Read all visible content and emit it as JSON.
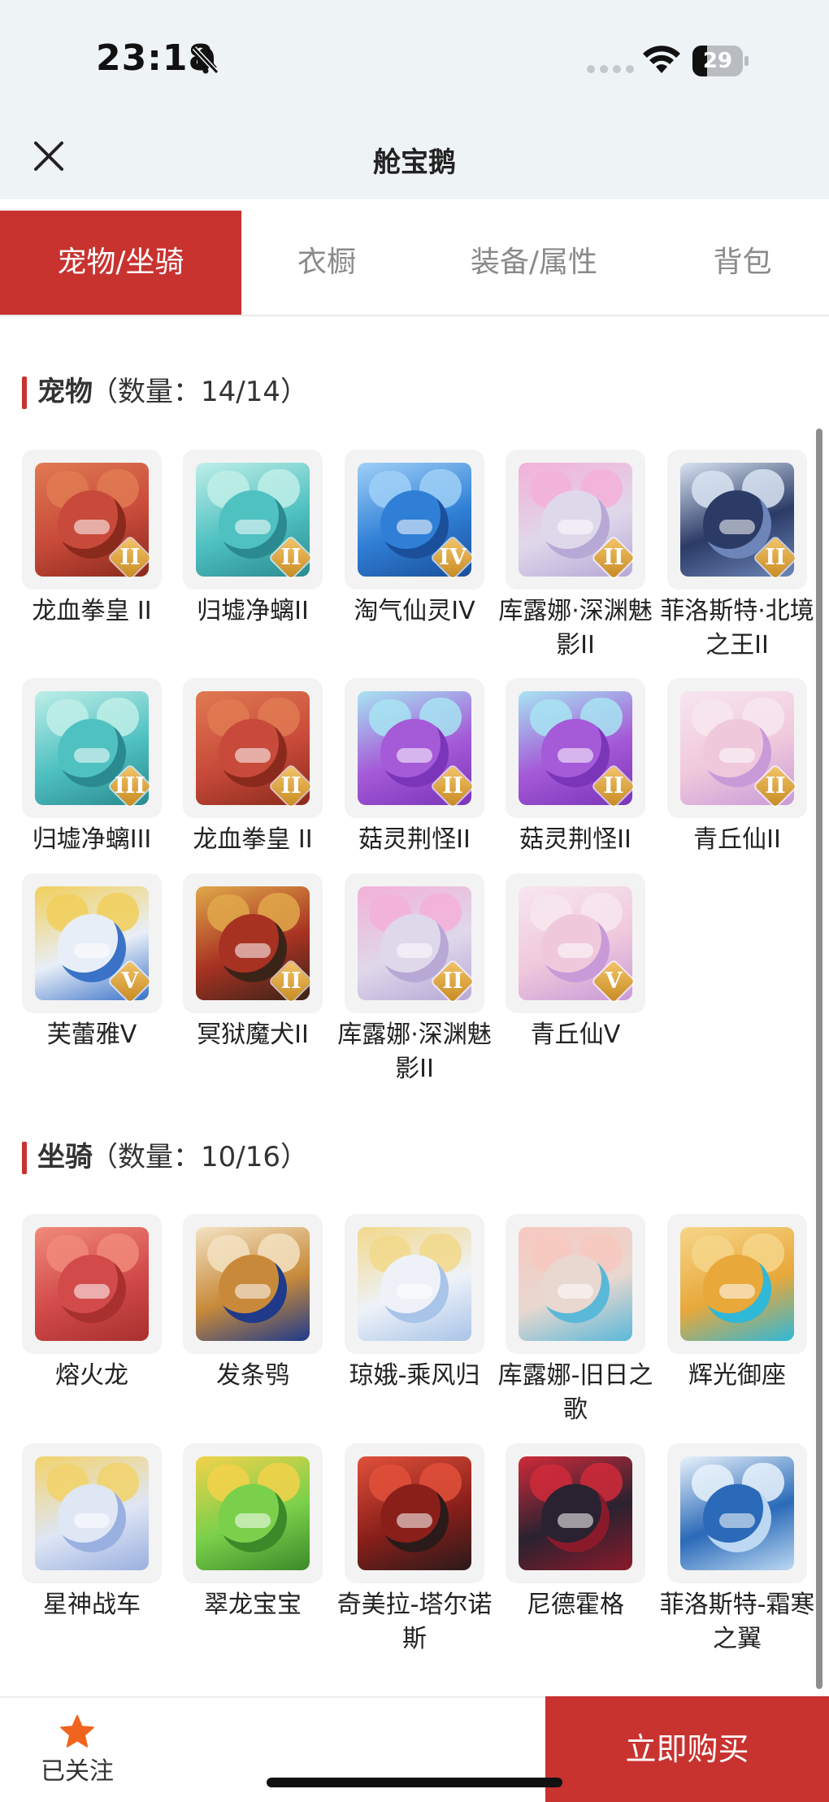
{
  "status_bar": {
    "time": "23:18",
    "battery": "29",
    "battery_level": 0.29
  },
  "header": {
    "title": "舱宝鹅"
  },
  "tabs": [
    {
      "label": "宠物/坐骑",
      "active": true
    },
    {
      "label": "衣橱",
      "active": false
    },
    {
      "label": "装备/属性",
      "active": false
    },
    {
      "label": "背包",
      "active": false
    }
  ],
  "pets": {
    "title": "宠物",
    "count": "（数量：14/14）",
    "items": [
      {
        "label": "龙血拳皇 II",
        "badge": "II",
        "colors": [
          "#c84a3a",
          "#8a2a1c",
          "#e07a52"
        ]
      },
      {
        "label": "归墟净螭II",
        "badge": "II",
        "colors": [
          "#4fc1c1",
          "#2a8a8f",
          "#bfeee8"
        ]
      },
      {
        "label": "淘气仙灵IV",
        "badge": "IV",
        "colors": [
          "#2f7fd6",
          "#1b4f9a",
          "#9fd0f7"
        ]
      },
      {
        "label": "库露娜·深渊魅影II",
        "badge": "II",
        "colors": [
          "#dfd8ea",
          "#b7a8d6",
          "#f3b0d8"
        ]
      },
      {
        "label": "菲洛斯特·北境之王II",
        "badge": "II",
        "colors": [
          "#2b3b66",
          "#6d85b8",
          "#d8e4f2"
        ]
      },
      {
        "label": "归墟净螭III",
        "badge": "III",
        "colors": [
          "#4fc1c1",
          "#2a8a8f",
          "#bfeee8"
        ]
      },
      {
        "label": "龙血拳皇 II",
        "badge": "II",
        "colors": [
          "#c84a3a",
          "#8a2a1c",
          "#e07a52"
        ]
      },
      {
        "label": "菇灵荆怪II",
        "badge": "II",
        "colors": [
          "#a55ad8",
          "#7a35b8",
          "#a7e4f2"
        ]
      },
      {
        "label": "菇灵荆怪II",
        "badge": "II",
        "colors": [
          "#a55ad8",
          "#7a35b8",
          "#a7e4f2"
        ]
      },
      {
        "label": "青丘仙II",
        "badge": "II",
        "colors": [
          "#f0c8dc",
          "#c89ad8",
          "#f7e6ef"
        ]
      },
      {
        "label": "芙蕾雅V",
        "badge": "V",
        "colors": [
          "#e8eef7",
          "#3a72c8",
          "#f1cf5a"
        ]
      },
      {
        "label": "冥狱魔犬II",
        "badge": "II",
        "colors": [
          "#a83222",
          "#3a2418",
          "#e0a84a"
        ]
      },
      {
        "label": "库露娜·深渊魅影II",
        "badge": "II",
        "colors": [
          "#dfd8ea",
          "#b7a8d6",
          "#f3b0d8"
        ]
      },
      {
        "label": "青丘仙V",
        "badge": "V",
        "colors": [
          "#f0c8dc",
          "#c89ad8",
          "#f7e6ef"
        ]
      }
    ]
  },
  "mounts": {
    "title": "坐骑",
    "count": "（数量：10/16）",
    "items": [
      {
        "label": "熔火龙",
        "colors": [
          "#d24a4a",
          "#a8302e",
          "#f08a7a"
        ]
      },
      {
        "label": "发条鸮",
        "colors": [
          "#c88a3a",
          "#1f3a8a",
          "#f3e2c2"
        ]
      },
      {
        "label": "琼娥-乘风归",
        "colors": [
          "#eef2f8",
          "#a8c4e8",
          "#f2d88a"
        ]
      },
      {
        "label": "库露娜-旧日之歌",
        "colors": [
          "#e8d8d0",
          "#5ab8d8",
          "#f7c8c0"
        ]
      },
      {
        "label": "辉光御座",
        "colors": [
          "#e8a83a",
          "#2fb8d8",
          "#f6d68a"
        ]
      },
      {
        "label": "星神战车",
        "colors": [
          "#dfe6f4",
          "#9ab0e0",
          "#f2d26a"
        ]
      },
      {
        "label": "翠龙宝宝",
        "colors": [
          "#7ad04a",
          "#3a8a2a",
          "#f2d24a"
        ]
      },
      {
        "label": "奇美拉-塔尔诺斯",
        "colors": [
          "#8a1f1a",
          "#2a1a1a",
          "#e0503a"
        ]
      },
      {
        "label": "尼德霍格",
        "colors": [
          "#2a2230",
          "#8a1a2a",
          "#d02a3a"
        ]
      },
      {
        "label": "菲洛斯特-霜寒之翼",
        "colors": [
          "#2a6ab8",
          "#bcd8f2",
          "#e8f2fb"
        ]
      }
    ]
  },
  "bottom_bar": {
    "follow_label": "已关注",
    "buy_label": "立即购买"
  },
  "theme": {
    "accent": "#c8322f",
    "star": "#f0641e"
  }
}
